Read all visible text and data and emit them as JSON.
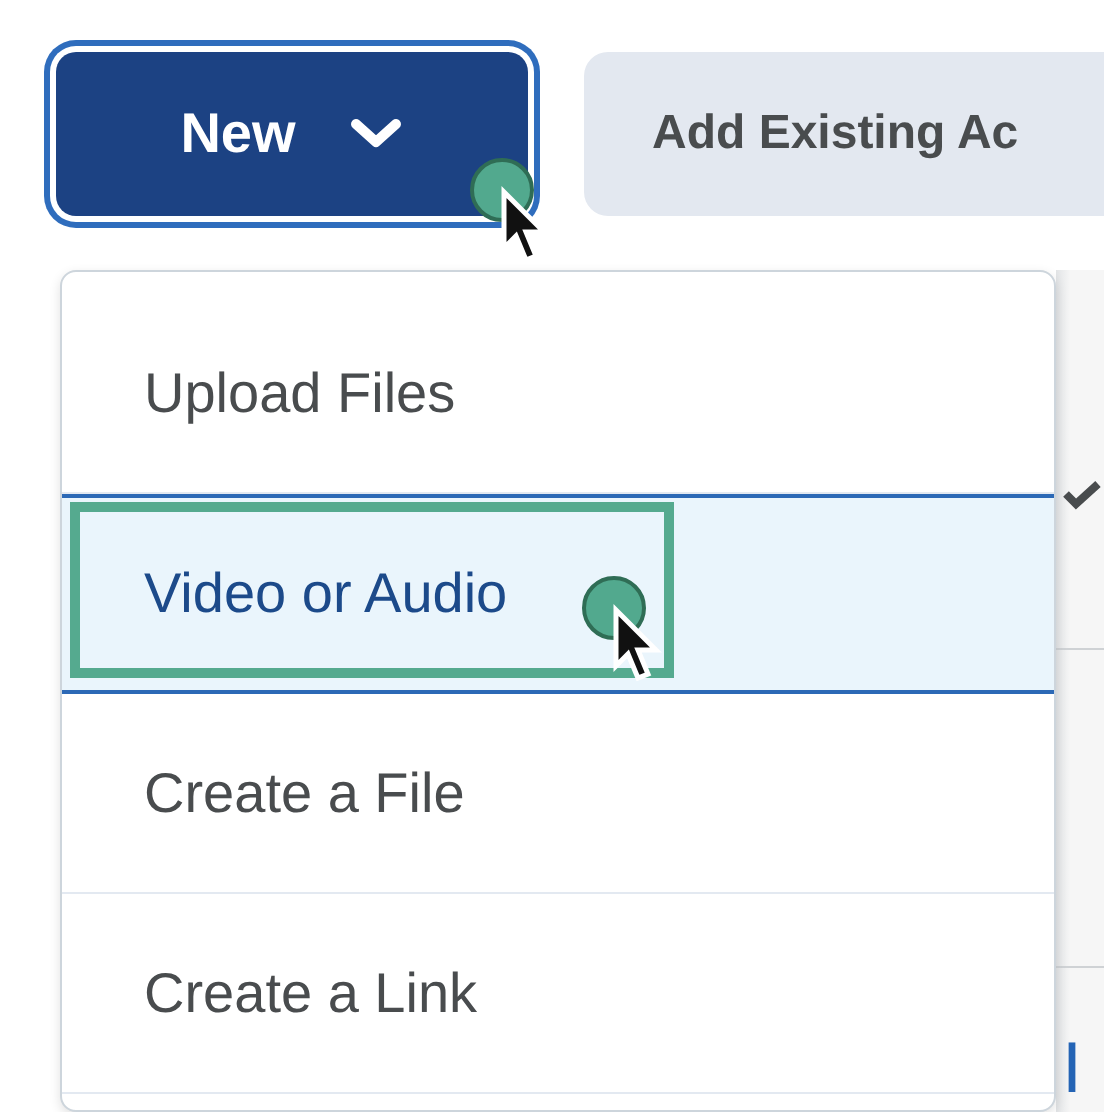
{
  "toolbar": {
    "new_button": {
      "label": "New",
      "focused": true
    },
    "add_existing_button": {
      "label": "Add Existing Ac"
    }
  },
  "menu": {
    "items": [
      {
        "label": "Upload Files",
        "selected": false
      },
      {
        "label": "Video or Audio",
        "selected": true
      },
      {
        "label": "Create a File",
        "selected": false
      },
      {
        "label": "Create a Link",
        "selected": false
      }
    ]
  },
  "background_list": {
    "link_text": "I"
  }
}
